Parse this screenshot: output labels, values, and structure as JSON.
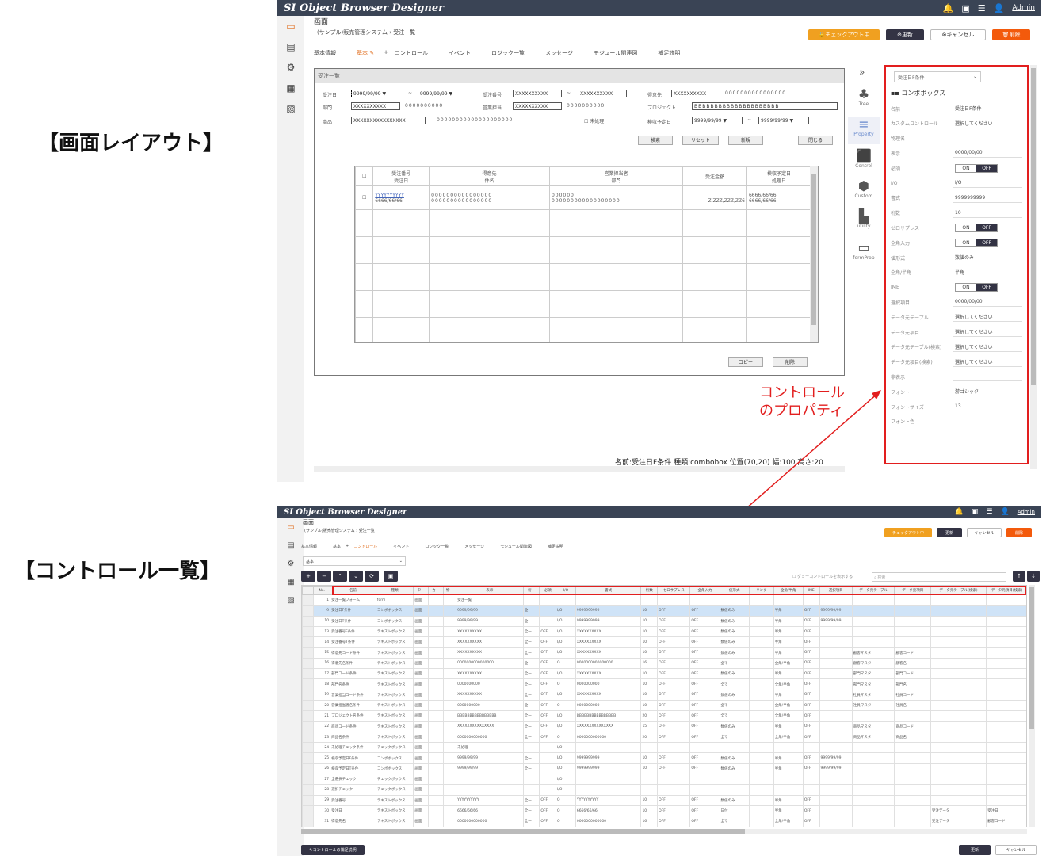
{
  "labels": {
    "screen_layout": "【画面レイアウト】",
    "control_list": "【コントロール一覧】"
  },
  "app": {
    "title": "SI Object Browser Designer",
    "user": "Admin"
  },
  "top": {
    "section": "画面",
    "breadcrumb": [
      "(サンプル)販売管理システム",
      "受注一覧"
    ],
    "buttons": {
      "checkout": "チェックアウト中",
      "update": "更新",
      "cancel": "キャンセル",
      "delete": "削除"
    },
    "tabs": [
      "基本情報",
      "基本",
      "+",
      "コントロール",
      "イベント",
      "ロジック一覧",
      "メッセージ",
      "モジュール関連図",
      "補足説明"
    ],
    "form": {
      "title": "受注一覧",
      "labels": [
        "受注日",
        "受注番号",
        "得意先",
        "部門",
        "営業担当",
        "プロジェクト",
        "検収予定日",
        "商品",
        "未処理"
      ],
      "values": {
        "date1": "9999/99/99",
        "date2": "9999/99/99",
        "no1": "XXXXXXXXXX",
        "no2": "XXXXXXXXXX",
        "cust": "XXXXXXXXXX",
        "cust_name": "0000000000000000",
        "dept": "XXXXXXXXXX",
        "dept_name": "0000000000",
        "sales": "XXXXXXXXXX",
        "sales_name": "0000000000",
        "proj": "BBBBBBBBBBBBBBBBBBBBB",
        "acc1": "9999/99/99",
        "acc2": "9999/99/99",
        "item": "XXXXXXXXXXXXXXXX",
        "item_name": "00000000000000000000"
      },
      "buttons": [
        "検索",
        "リセット",
        "新規",
        "閉じる",
        "コピー",
        "削除"
      ],
      "grid_headers": [
        [
          "受注番号",
          "受注日"
        ],
        [
          "得意先",
          "件名"
        ],
        [
          "営業担当者",
          "部門"
        ],
        [
          "",
          "受注金額"
        ],
        [
          "検収予定日",
          "処理日"
        ]
      ],
      "grid_row": [
        [
          "YYYYYYYYYY",
          "6666/66/66"
        ],
        [
          "0000000000000000",
          "0000000000000000"
        ],
        [
          "000000",
          "000000000000000000"
        ],
        [
          "",
          "Z,ZZZ,ZZZ,ZZ6"
        ],
        [
          "6666/66/66",
          "6666/66/66"
        ]
      ]
    },
    "status": "名前:受注日F条件 種類:combobox 位置(70,20) 幅:100 高さ:20",
    "tools": [
      "Tree",
      "Property",
      "Control",
      "Custom",
      "utility",
      "formProp"
    ],
    "props": {
      "header": "受注日F条件",
      "type": "コンボボックス",
      "rows": [
        [
          "名前",
          "受注日F条件"
        ],
        [
          "カスタムコントロール",
          "選択してください"
        ],
        [
          "物理名",
          ""
        ],
        [
          "表示",
          "0000/00/00"
        ],
        [
          "必須",
          "toggle-off"
        ],
        [
          "I/O",
          "I/O"
        ],
        [
          "書式",
          "9999999999"
        ],
        [
          "桁数",
          "10"
        ],
        [
          "ゼロサプレス",
          "toggle-off"
        ],
        [
          "全角入力",
          "toggle-off"
        ],
        [
          "値形式",
          "数値のみ"
        ],
        [
          "全角/半角",
          "半角"
        ],
        [
          "IME",
          "toggle-off"
        ],
        [
          "選択項目",
          "0000/00/00"
        ],
        [
          "データ元テーブル",
          "選択してください"
        ],
        [
          "データ元項目",
          "選択してください"
        ],
        [
          "データ元テーブル(検索)",
          "選択してください"
        ],
        [
          "データ元項目(検索)",
          "選択してください"
        ],
        [
          "非表示",
          ""
        ],
        [
          "フォント",
          "游ゴシック"
        ],
        [
          "フォントサイズ",
          "13"
        ],
        [
          "フォント色",
          ""
        ]
      ]
    },
    "note": [
      "コントロール",
      "のプロパティ"
    ]
  },
  "bottom": {
    "view": "基本",
    "dummy": "ダミーコントロールを表示する",
    "search_placeholder": "検索",
    "headers": [
      "No.",
      "名前",
      "種類",
      "ター",
      "カー",
      "物一",
      "表示",
      "桁一",
      "必須",
      "I/O",
      "書式",
      "桁数",
      "ゼロサプレス",
      "全角入力",
      "値形式",
      "リンク",
      "全角/半角",
      "IME",
      "選択項目",
      "データ元テーブル",
      "データ元項目",
      "データ元テーブル(検索)",
      "データ元項目(検索)"
    ],
    "rows": [
      [
        "1",
        "受注一覧フォーム",
        "form",
        "画面",
        "",
        "",
        "受注一覧",
        "",
        "",
        "",
        "",
        "",
        "",
        "",
        "",
        "",
        "",
        "",
        "",
        "",
        "",
        "",
        ""
      ],
      [
        "9",
        "受注日F条件",
        "コンボボックス",
        "画面",
        "",
        "",
        "9999/99/99",
        "全一",
        "",
        "I/O",
        "9999999999",
        "10",
        "OFF",
        "OFF",
        "数値のみ",
        "",
        "半角",
        "OFF",
        "9999/99/99",
        "",
        "",
        "",
        ""
      ],
      [
        "10",
        "受注日T条件",
        "コンボボックス",
        "画面",
        "",
        "",
        "9999/99/99",
        "全一",
        "",
        "I/O",
        "9999999999",
        "10",
        "OFF",
        "OFF",
        "数値のみ",
        "",
        "半角",
        "OFF",
        "9999/99/99",
        "",
        "",
        "",
        ""
      ],
      [
        "13",
        "受注番号F条件",
        "テキストボックス",
        "画面",
        "",
        "",
        "XXXXXXXXXX",
        "全一",
        "OFF",
        "I/O",
        "XXXXXXXXXX",
        "10",
        "OFF",
        "OFF",
        "数値のみ",
        "",
        "半角",
        "OFF",
        "",
        "",
        "",
        "",
        ""
      ],
      [
        "14",
        "受注番号T条件",
        "テキストボックス",
        "画面",
        "",
        "",
        "XXXXXXXXXX",
        "全一",
        "OFF",
        "I/O",
        "XXXXXXXXXX",
        "10",
        "OFF",
        "OFF",
        "数値のみ",
        "",
        "半角",
        "OFF",
        "",
        "",
        "",
        "",
        ""
      ],
      [
        "15",
        "得意先コード条件",
        "テキストボックス",
        "画面",
        "",
        "",
        "XXXXXXXXXX",
        "全一",
        "OFF",
        "I/O",
        "XXXXXXXXXX",
        "10",
        "OFF",
        "OFF",
        "数値のみ",
        "",
        "半角",
        "OFF",
        "",
        "顧客マスタ",
        "顧客コード",
        "",
        ""
      ],
      [
        "16",
        "得意先名条件",
        "テキストボックス",
        "画面",
        "",
        "",
        "0000000000000000",
        "全一",
        "OFF",
        "O",
        "0000000000000000",
        "16",
        "OFF",
        "OFF",
        "全て",
        "",
        "全角/半角",
        "OFF",
        "",
        "顧客マスタ",
        "顧客名",
        "",
        ""
      ],
      [
        "17",
        "部門コード条件",
        "テキストボックス",
        "画面",
        "",
        "",
        "XXXXXXXXXX",
        "全一",
        "OFF",
        "I/O",
        "XXXXXXXXXX",
        "10",
        "OFF",
        "OFF",
        "数値のみ",
        "",
        "半角",
        "OFF",
        "",
        "部門マスタ",
        "部門コード",
        "",
        ""
      ],
      [
        "18",
        "部門名条件",
        "テキストボックス",
        "画面",
        "",
        "",
        "0000000000",
        "全一",
        "OFF",
        "O",
        "0000000000",
        "10",
        "OFF",
        "OFF",
        "全て",
        "",
        "全角/半角",
        "OFF",
        "",
        "部門マスタ",
        "部門名",
        "",
        ""
      ],
      [
        "19",
        "営業担当コード条件",
        "テキストボックス",
        "画面",
        "",
        "",
        "XXXXXXXXXX",
        "全一",
        "OFF",
        "I/O",
        "XXXXXXXXXX",
        "10",
        "OFF",
        "OFF",
        "数値のみ",
        "",
        "半角",
        "OFF",
        "",
        "社員マスタ",
        "社員コード",
        "",
        ""
      ],
      [
        "20",
        "営業担当者名条件",
        "テキストボックス",
        "画面",
        "",
        "",
        "0000000000",
        "全一",
        "OFF",
        "O",
        "0000000000",
        "10",
        "OFF",
        "OFF",
        "全て",
        "",
        "全角/半角",
        "OFF",
        "",
        "社員マスタ",
        "社員名",
        "",
        ""
      ],
      [
        "21",
        "プロジェクト名条件",
        "テキストボックス",
        "画面",
        "",
        "",
        "BBBBBBBBBBBBBBBB",
        "全一",
        "OFF",
        "I/O",
        "BBBBBBBBBBBBBBBB",
        "20",
        "OFF",
        "OFF",
        "全て",
        "",
        "全角/半角",
        "OFF",
        "",
        "",
        "",
        "",
        ""
      ],
      [
        "22",
        "商品コード条件",
        "テキストボックス",
        "画面",
        "",
        "",
        "XXXXXXXXXXXXXXX",
        "全一",
        "OFF",
        "I/O",
        "XXXXXXXXXXXXXXX",
        "15",
        "OFF",
        "OFF",
        "数値のみ",
        "",
        "半角",
        "OFF",
        "",
        "商品マスタ",
        "商品コード",
        "",
        ""
      ],
      [
        "23",
        "商品名条件",
        "テキストボックス",
        "画面",
        "",
        "",
        "0000000000000",
        "全一",
        "OFF",
        "O",
        "0000000000000",
        "20",
        "OFF",
        "OFF",
        "全て",
        "",
        "全角/半角",
        "OFF",
        "",
        "商品マスタ",
        "商品名",
        "",
        ""
      ],
      [
        "24",
        "未処理チェック条件",
        "チェックボックス",
        "画面",
        "",
        "",
        "未処理",
        "",
        "",
        "I/O",
        "",
        "",
        "",
        "",
        "",
        "",
        "",
        "",
        "",
        "",
        "",
        "",
        ""
      ],
      [
        "25",
        "検収予定日F条件",
        "コンボボックス",
        "画面",
        "",
        "",
        "9999/99/99",
        "全一",
        "",
        "I/O",
        "9999999999",
        "10",
        "OFF",
        "OFF",
        "数値のみ",
        "",
        "半角",
        "OFF",
        "9999/99/99",
        "",
        "",
        "",
        ""
      ],
      [
        "26",
        "検収予定日T条件",
        "コンボボックス",
        "画面",
        "",
        "",
        "9999/99/99",
        "全一",
        "",
        "I/O",
        "9999999999",
        "10",
        "OFF",
        "OFF",
        "数値のみ",
        "",
        "半角",
        "OFF",
        "9999/99/99",
        "",
        "",
        "",
        ""
      ],
      [
        "27",
        "全選択チェック",
        "チェックボックス",
        "画面",
        "",
        "",
        "",
        "",
        "",
        "I/O",
        "",
        "",
        "",
        "",
        "",
        "",
        "",
        "",
        "",
        "",
        "",
        "",
        ""
      ],
      [
        "28",
        "選択チェック",
        "チェックボックス",
        "画面",
        "",
        "",
        "",
        "",
        "",
        "I/O",
        "",
        "",
        "",
        "",
        "",
        "",
        "",
        "",
        "",
        "",
        "",
        "",
        ""
      ],
      [
        "29",
        "受注番号",
        "テキストボックス",
        "画面",
        "",
        "",
        "YYYYYYYYYY",
        "全一",
        "OFF",
        "O",
        "YYYYYYYYYY",
        "10",
        "OFF",
        "OFF",
        "数値のみ",
        "",
        "半角",
        "OFF",
        "",
        "",
        "",
        "",
        ""
      ],
      [
        "30",
        "受注日",
        "テキストボックス",
        "画面",
        "",
        "",
        "6666/66/66",
        "全一",
        "OFF",
        "O",
        "6666/66/66",
        "10",
        "OFF",
        "OFF",
        "日付",
        "",
        "半角",
        "OFF",
        "",
        "",
        "",
        "受注データ",
        "受注日"
      ],
      [
        "31",
        "得意先名",
        "テキストボックス",
        "画面",
        "",
        "",
        "0000000000000",
        "全一",
        "OFF",
        "O",
        "0000000000000",
        "16",
        "OFF",
        "OFF",
        "全て",
        "",
        "全角/半角",
        "OFF",
        "",
        "",
        "",
        "受注データ",
        "顧客コード"
      ]
    ],
    "footer_button": "コントロールの補足説明",
    "footer_update": "更新",
    "footer_cancel": "キャンセル"
  }
}
